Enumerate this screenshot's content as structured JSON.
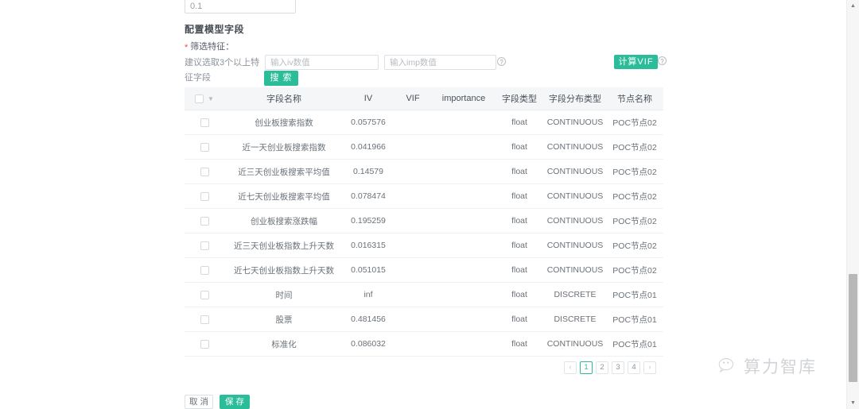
{
  "top_input": {
    "value": "0.1"
  },
  "section": {
    "title": "配置模型字段",
    "required_label": "筛选特征：",
    "required_star": "*",
    "hint": "建议选取3个以上特征字段"
  },
  "filters": {
    "iv_placeholder": "输入iv数值",
    "iv_value": "",
    "imp_placeholder": "输入imp数值",
    "imp_value": "",
    "help_icon": "question-circle-icon",
    "vif_button": "计算VIF",
    "search_button": "搜 索"
  },
  "table": {
    "select_all_icon": "checkbox-icon",
    "select_all_chevron": "chevron-down-icon",
    "columns": [
      "字段名称",
      "IV",
      "VIF",
      "importance",
      "字段类型",
      "字段分布类型",
      "节点名称"
    ],
    "rows": [
      {
        "name": "创业板搜索指数",
        "iv": "0.057576",
        "vif": "",
        "importance": "",
        "ftype": "float",
        "dtype": "CONTINUOUS",
        "node": "POC节点02"
      },
      {
        "name": "近一天创业板搜索指数",
        "iv": "0.041966",
        "vif": "",
        "importance": "",
        "ftype": "float",
        "dtype": "CONTINUOUS",
        "node": "POC节点02"
      },
      {
        "name": "近三天创业板搜索平均值",
        "iv": "0.14579",
        "vif": "",
        "importance": "",
        "ftype": "float",
        "dtype": "CONTINUOUS",
        "node": "POC节点02"
      },
      {
        "name": "近七天创业板搜索平均值",
        "iv": "0.078474",
        "vif": "",
        "importance": "",
        "ftype": "float",
        "dtype": "CONTINUOUS",
        "node": "POC节点02"
      },
      {
        "name": "创业板搜索涨跌幅",
        "iv": "0.195259",
        "vif": "",
        "importance": "",
        "ftype": "float",
        "dtype": "CONTINUOUS",
        "node": "POC节点02"
      },
      {
        "name": "近三天创业板指数上升天数",
        "iv": "0.016315",
        "vif": "",
        "importance": "",
        "ftype": "float",
        "dtype": "CONTINUOUS",
        "node": "POC节点02"
      },
      {
        "name": "近七天创业板指数上升天数",
        "iv": "0.051015",
        "vif": "",
        "importance": "",
        "ftype": "float",
        "dtype": "CONTINUOUS",
        "node": "POC节点02"
      },
      {
        "name": "时间",
        "iv": "inf",
        "vif": "",
        "importance": "",
        "ftype": "float",
        "dtype": "DISCRETE",
        "node": "POC节点01"
      },
      {
        "name": "股票",
        "iv": "0.481456",
        "vif": "",
        "importance": "",
        "ftype": "float",
        "dtype": "DISCRETE",
        "node": "POC节点01"
      },
      {
        "name": "标准化",
        "iv": "0.086032",
        "vif": "",
        "importance": "",
        "ftype": "float",
        "dtype": "CONTINUOUS",
        "node": "POC节点01"
      }
    ]
  },
  "pagination": {
    "prev": "‹",
    "pages": [
      "1",
      "2",
      "3",
      "4"
    ],
    "current": "1",
    "next": "›"
  },
  "footer": {
    "cancel": "取 消",
    "save": "保 存"
  },
  "watermark": {
    "text": "算力智库",
    "icon": "wechat-icon"
  },
  "scrollbar": {
    "up_arrow": "▲",
    "down_arrow": "▼"
  },
  "colors": {
    "accent": "#2bbd99",
    "required": "#e8503a",
    "header_bg": "#f5f6f8",
    "border": "#dcdfe3"
  }
}
